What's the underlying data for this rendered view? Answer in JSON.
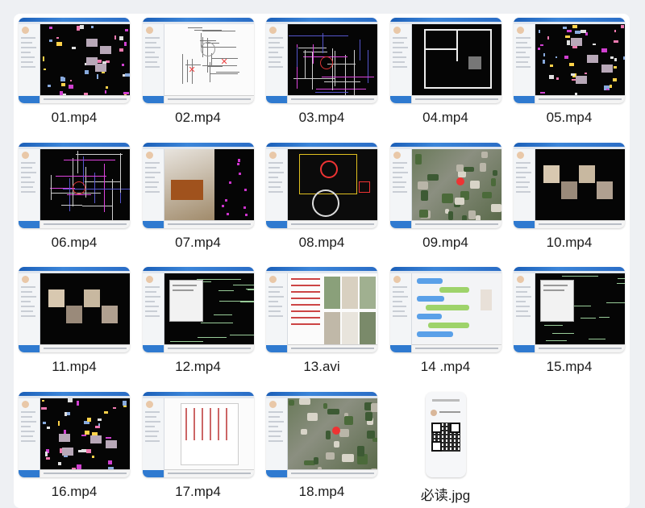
{
  "files": [
    {
      "name": "01.mp4",
      "style": "cad-dots"
    },
    {
      "name": "02.mp4",
      "style": "white-plan"
    },
    {
      "name": "03.mp4",
      "style": "cad-lines"
    },
    {
      "name": "04.mp4",
      "style": "floorplan"
    },
    {
      "name": "05.mp4",
      "style": "cad-dots"
    },
    {
      "name": "06.mp4",
      "style": "cad-lines"
    },
    {
      "name": "07.mp4",
      "style": "photo-room"
    },
    {
      "name": "08.mp4",
      "style": "cad-color"
    },
    {
      "name": "09.mp4",
      "style": "satellite"
    },
    {
      "name": "10.mp4",
      "style": "photos-dark"
    },
    {
      "name": "11.mp4",
      "style": "photos-dark"
    },
    {
      "name": "12.mp4",
      "style": "cad-dialog"
    },
    {
      "name": "13.avi",
      "style": "photo-collage"
    },
    {
      "name": "14 .mp4",
      "style": "chat"
    },
    {
      "name": "15.mp4",
      "style": "cad-dialog"
    },
    {
      "name": "16.mp4",
      "style": "cad-dots"
    },
    {
      "name": "17.mp4",
      "style": "document"
    },
    {
      "name": "18.mp4",
      "style": "satellite"
    },
    {
      "name": "必读.jpg",
      "style": "phone-qr"
    }
  ],
  "colors": {
    "titlebar": "#2a6dc6",
    "cad_bg": "#050505",
    "panel": "#ffffff",
    "page": "#eef0f3"
  }
}
